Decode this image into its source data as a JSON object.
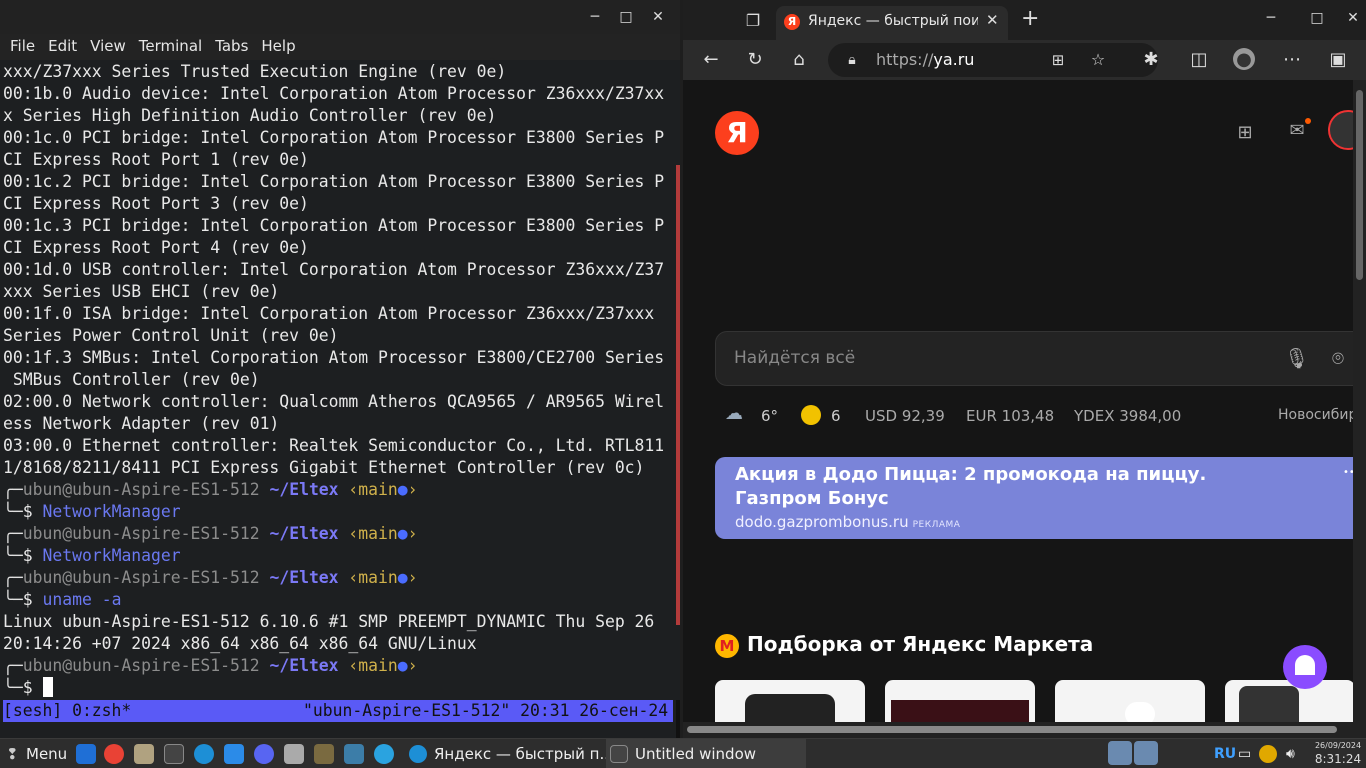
{
  "terminal": {
    "window_controls": {
      "minimize": "─",
      "maximize": "□",
      "close": "✕"
    },
    "menu": [
      "File",
      "Edit",
      "View",
      "Terminal",
      "Tabs",
      "Help"
    ],
    "output_lines": [
      "xxx/Z37xxx Series Trusted Execution Engine (rev 0e)",
      "00:1b.0 Audio device: Intel Corporation Atom Processor Z36xxx/Z37xx",
      "x Series High Definition Audio Controller (rev 0e)",
      "00:1c.0 PCI bridge: Intel Corporation Atom Processor E3800 Series P",
      "CI Express Root Port 1 (rev 0e)",
      "00:1c.2 PCI bridge: Intel Corporation Atom Processor E3800 Series P",
      "CI Express Root Port 3 (rev 0e)",
      "00:1c.3 PCI bridge: Intel Corporation Atom Processor E3800 Series P",
      "CI Express Root Port 4 (rev 0e)",
      "00:1d.0 USB controller: Intel Corporation Atom Processor Z36xxx/Z37",
      "xxx Series USB EHCI (rev 0e)",
      "00:1f.0 ISA bridge: Intel Corporation Atom Processor Z36xxx/Z37xxx",
      "Series Power Control Unit (rev 0e)",
      "00:1f.3 SMBus: Intel Corporation Atom Processor E3800/CE2700 Series",
      " SMBus Controller (rev 0e)",
      "02:00.0 Network controller: Qualcomm Atheros QCA9565 / AR9565 Wirel",
      "ess Network Adapter (rev 01)",
      "03:00.0 Ethernet controller: Realtek Semiconductor Co., Ltd. RTL811",
      "1/8168/8211/8411 PCI Express Gigabit Ethernet Controller (rev 0c)"
    ],
    "prompt": {
      "user_host": "ubun@ubun-Aspire-ES1-512",
      "dir": "~/Eltex",
      "branch": "‹main",
      "branch_close": "›",
      "dot": "●",
      "symbol": "$"
    },
    "commands": [
      "NetworkManager",
      "NetworkManager",
      "uname -a",
      ""
    ],
    "uname_output": [
      "Linux ubun-Aspire-ES1-512 6.10.6 #1 SMP PREEMPT_DYNAMIC Thu Sep 26",
      "20:14:26 +07 2024 x86_64 x86_64 x86_64 GNU/Linux"
    ],
    "status_left": "[sesh] 0:zsh*",
    "status_right": "\"ubun-Aspire-ES1-512\" 20:31 26-сен-24"
  },
  "browser": {
    "tab_title": "Яндекс — быстрый поиск",
    "tab_fav": "Я",
    "url_prefix": "https://",
    "url_host": "ya.ru",
    "logo": "Я",
    "search_placeholder": "Найдётся всё",
    "weather_temp": "6°",
    "traffic": "6",
    "usd": "USD 92,39",
    "eur": "EUR 103,48",
    "ydex": "YDEX 3984,00",
    "city": "Новосибирск",
    "ad_title": "Акция в Додо Пицца: 2 промокода на пиццу. Газпром Бонус",
    "ad_domain": "dodo.gazprombonus.ru",
    "ad_label": "РЕКЛАМА",
    "market_title": "Подборка от Яндекс Маркета",
    "market_icon": "М"
  },
  "taskbar": {
    "menu_label": "Menu",
    "task_browser": "Яндекс — быстрый п...",
    "task_terminal": "Untitled window",
    "lang": "RU",
    "date": "26/09/2024",
    "time": "8:31:24"
  },
  "colors": {
    "accent_terminal_status": "#5a5af6",
    "yandex_red": "#fc3f1d",
    "ad_bg": "#7a84d9"
  }
}
